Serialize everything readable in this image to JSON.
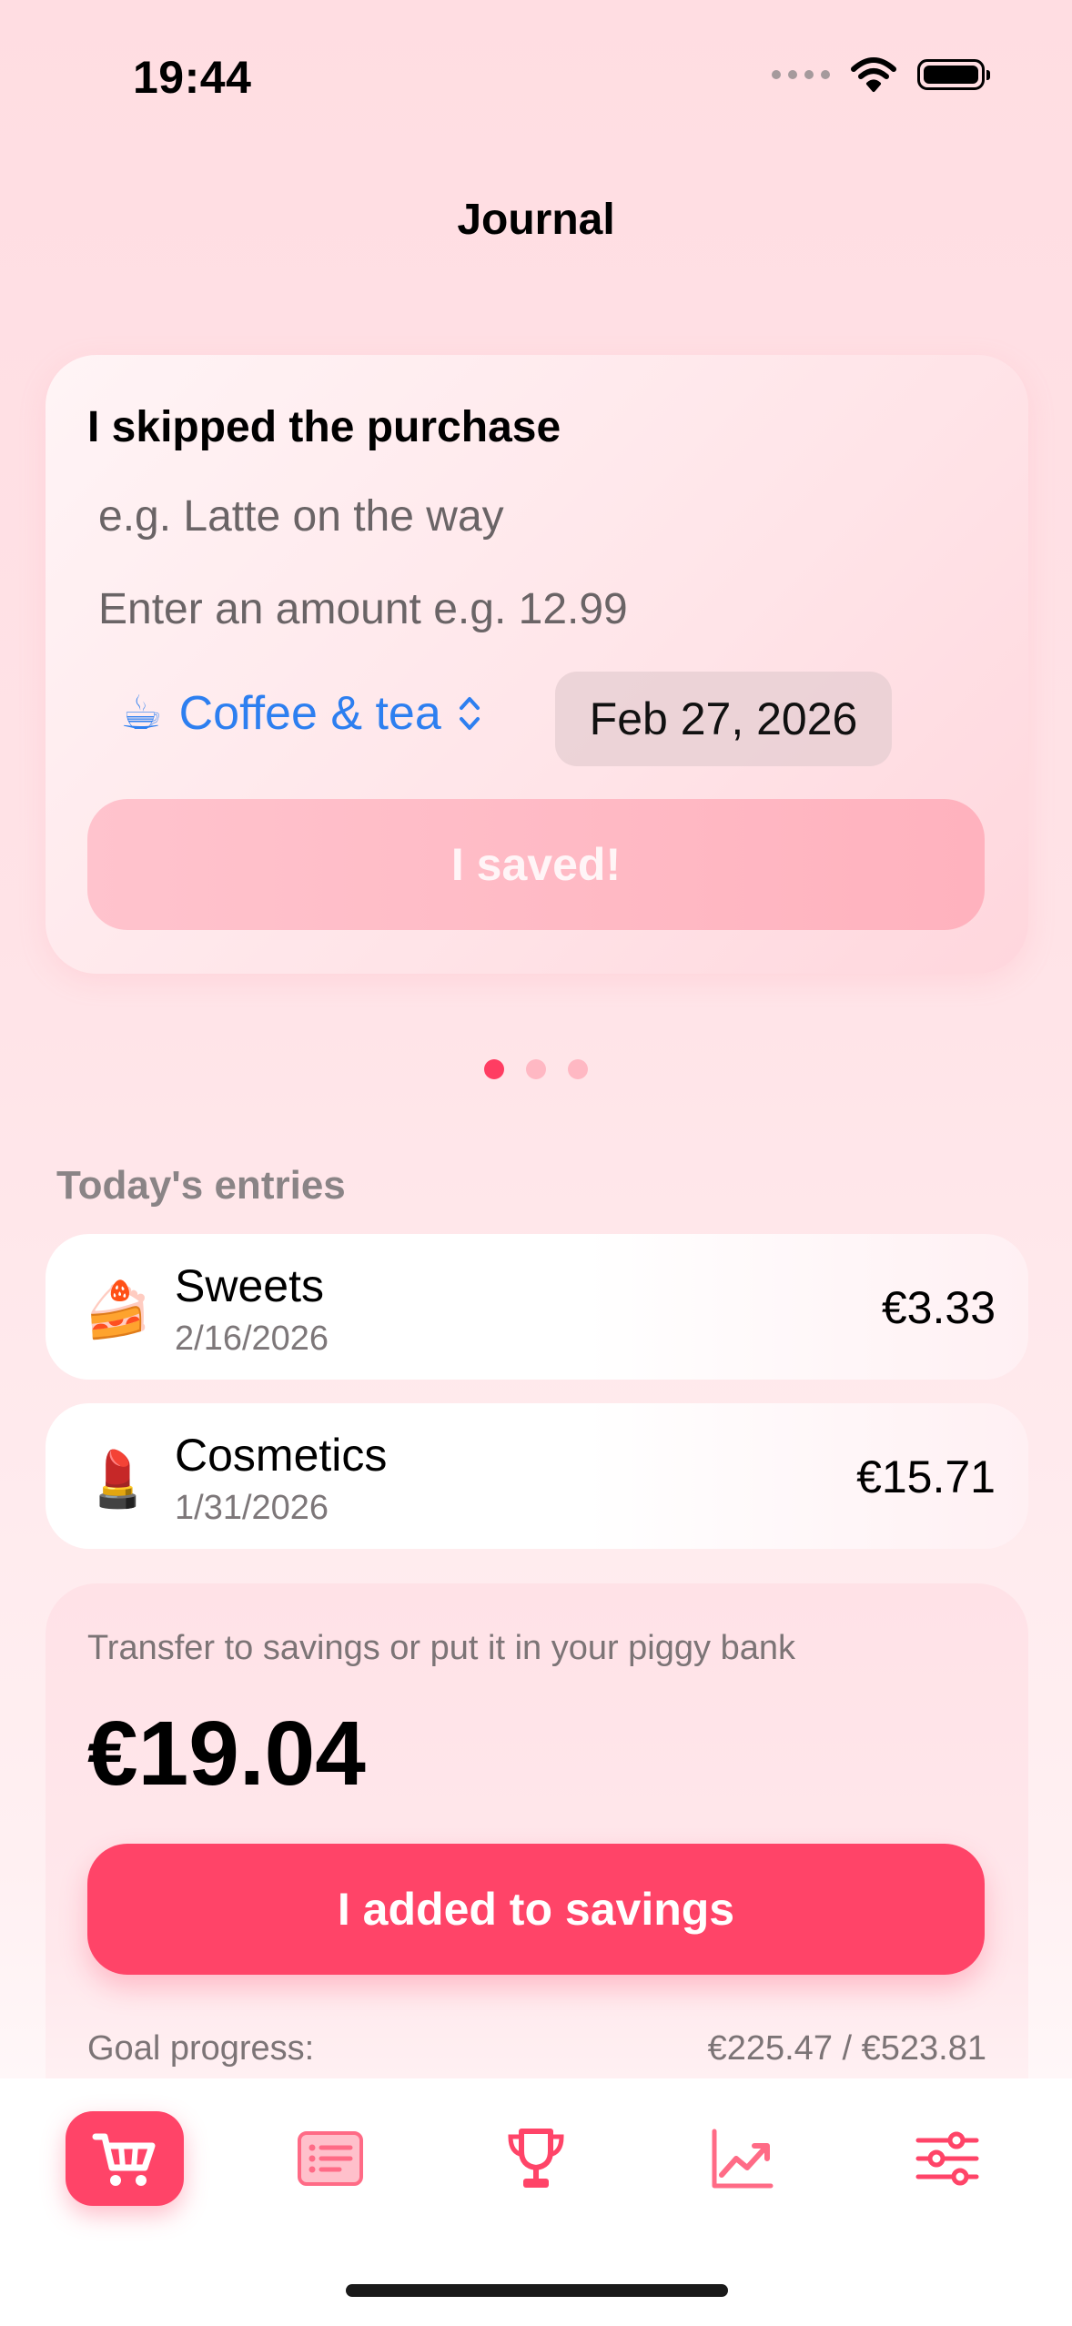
{
  "status_bar": {
    "time": "19:44"
  },
  "nav": {
    "title": "Journal"
  },
  "entry_form": {
    "title": "I skipped the purchase",
    "description_placeholder": "e.g. Latte on the way",
    "amount_placeholder": "Enter an amount e.g. 12.99",
    "category": {
      "emoji": "☕",
      "label": "Coffee & tea"
    },
    "date": "Feb 27, 2026",
    "submit_label": "I saved!"
  },
  "pager": {
    "pages": 3,
    "active": 0
  },
  "today_entries": {
    "header": "Today's entries",
    "items": [
      {
        "emoji": "🍰",
        "name": "Sweets",
        "date": "2/16/2026",
        "amount": "€3.33"
      },
      {
        "emoji": "💄",
        "name": "Cosmetics",
        "date": "1/31/2026",
        "amount": "€15.71"
      }
    ]
  },
  "savings": {
    "hint": "Transfer to savings or put it in your piggy bank",
    "amount": "€19.04",
    "button_label": "I added to savings",
    "goal_label": "Goal progress:",
    "goal_value": "€225.47 / €523.81"
  },
  "tab_bar": {
    "tabs": [
      {
        "icon": "cart-icon",
        "active": true
      },
      {
        "icon": "list-icon",
        "active": false
      },
      {
        "icon": "trophy-icon",
        "active": false
      },
      {
        "icon": "chart-icon",
        "active": false
      },
      {
        "icon": "sliders-icon",
        "active": false
      }
    ]
  },
  "colors": {
    "accent": "#ff4468",
    "link": "#2d7ff0",
    "page_dot_active": "#ff3d62"
  }
}
